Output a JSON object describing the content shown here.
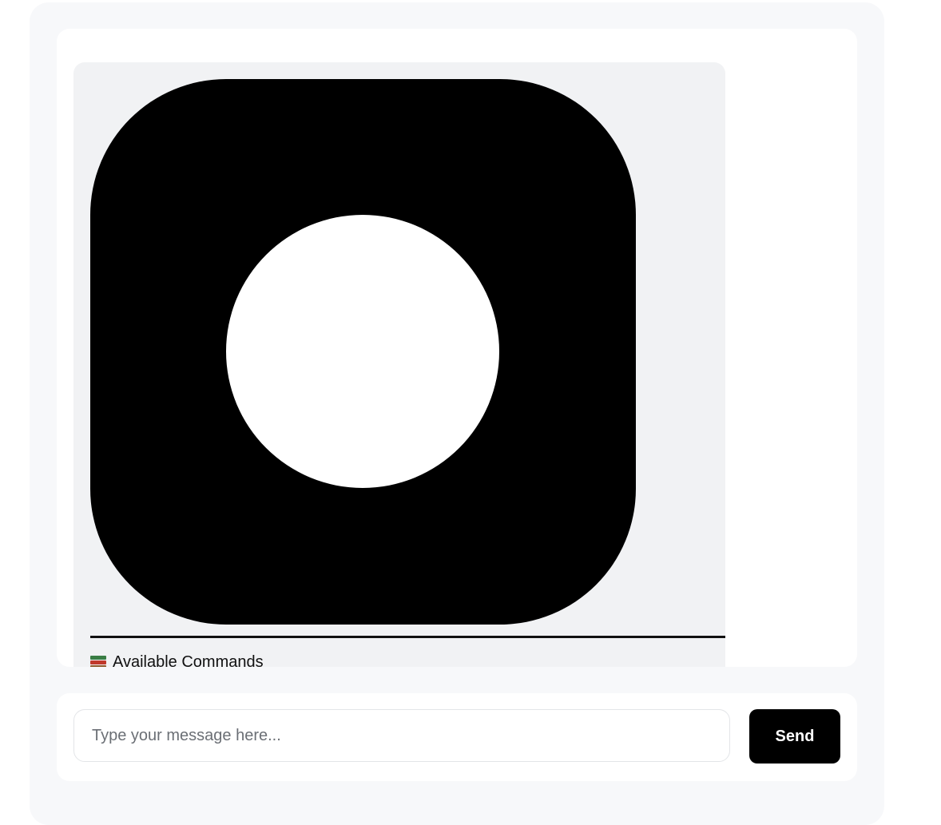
{
  "chat": {
    "commands_heading": "Available Commands",
    "heading_icon": "books-icon"
  },
  "composer": {
    "placeholder": "Type your message here...",
    "send_label": "Send"
  },
  "colors": {
    "accent": "#000000",
    "shell_background": "#f7f8fa",
    "bubble_background": "#f1f2f4"
  }
}
